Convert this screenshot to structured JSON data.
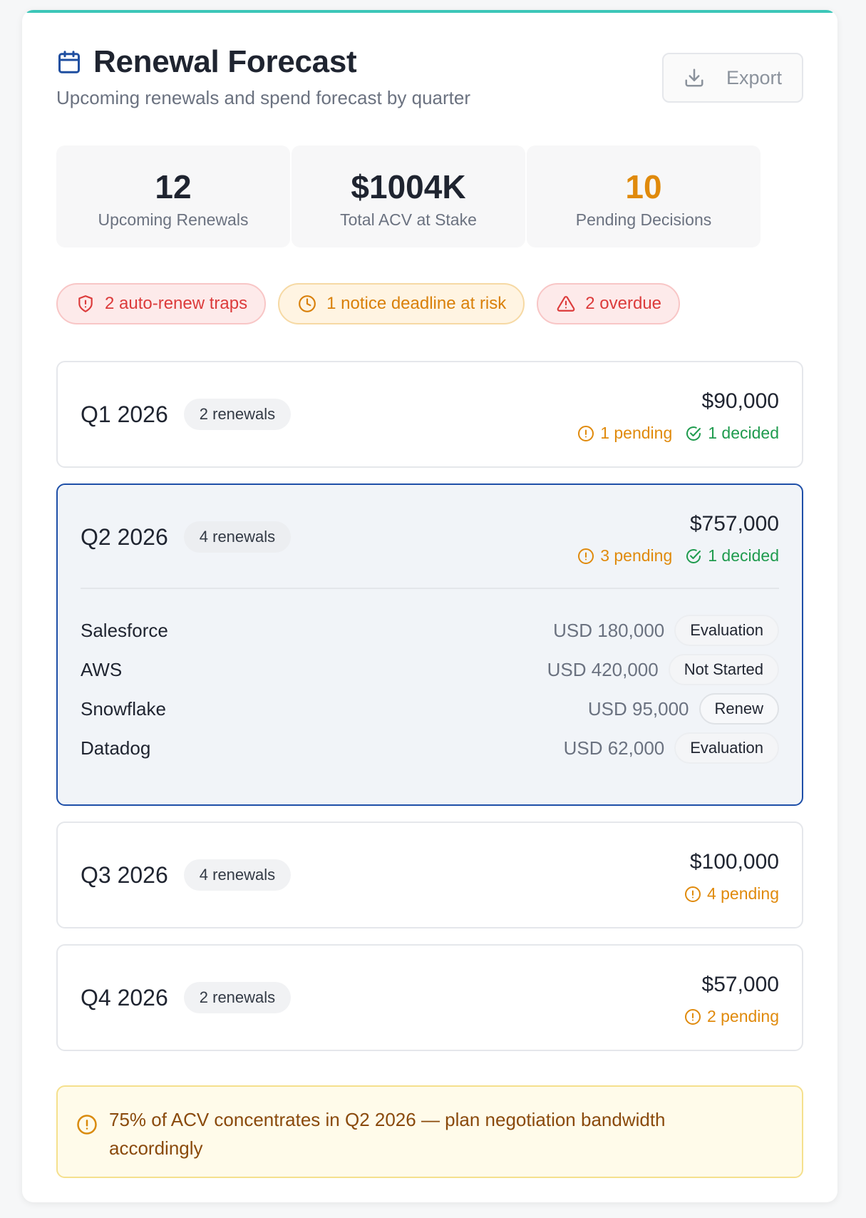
{
  "header": {
    "title": "Renewal Forecast",
    "subtitle": "Upcoming renewals and spend forecast by quarter",
    "export_label": "Export"
  },
  "stats": [
    {
      "value": "12",
      "label": "Upcoming Renewals"
    },
    {
      "value": "$1004K",
      "label": "Total ACV at Stake"
    },
    {
      "value": "10",
      "label": "Pending Decisions"
    }
  ],
  "alerts": {
    "traps": "2 auto-renew traps",
    "notice": "1 notice deadline at risk",
    "overdue": "2 overdue"
  },
  "quarters": [
    {
      "label": "Q1 2026",
      "count": "2 renewals",
      "amount": "$90,000",
      "pending": "1 pending",
      "decided": "1 decided"
    },
    {
      "label": "Q2 2026",
      "count": "4 renewals",
      "amount": "$757,000",
      "pending": "3 pending",
      "decided": "1 decided",
      "vendors": [
        {
          "name": "Salesforce",
          "amount": "USD 180,000",
          "status": "Evaluation"
        },
        {
          "name": "AWS",
          "amount": "USD 420,000",
          "status": "Not Started"
        },
        {
          "name": "Snowflake",
          "amount": "USD 95,000",
          "status": "Renew"
        },
        {
          "name": "Datadog",
          "amount": "USD 62,000",
          "status": "Evaluation"
        }
      ]
    },
    {
      "label": "Q3 2026",
      "count": "4 renewals",
      "amount": "$100,000",
      "pending": "4 pending"
    },
    {
      "label": "Q4 2026",
      "count": "2 renewals",
      "amount": "$57,000",
      "pending": "2 pending"
    }
  ],
  "warning": "75% of ACV concentrates in Q2 2026 — plan negotiation bandwidth accordingly",
  "colors": {
    "accent": "#3cc6b8",
    "active_border": "#1e4fa8",
    "pending": "#e08a0c",
    "decided": "#1f9b4e",
    "danger": "#dc3b3b"
  }
}
